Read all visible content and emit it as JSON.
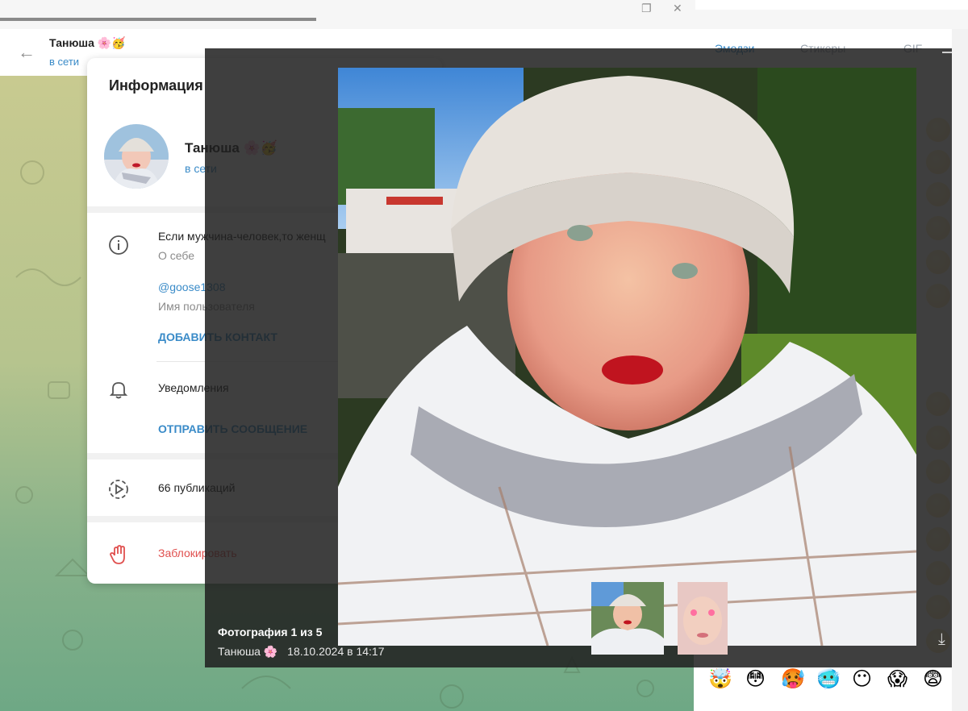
{
  "window": {
    "restore_icon": "restore-window-icon",
    "close_icon": "close-icon"
  },
  "chat": {
    "name": "Танюша 🌸🥳",
    "status": "в сети"
  },
  "emoji_panel": {
    "tabs": [
      "Эмодзи",
      "Стикеры",
      "GIF"
    ],
    "active_tab": "Эмодзи",
    "bottom_emojis": [
      "🤯",
      "😳",
      "🥵",
      "🥶",
      "😶",
      "😱",
      "😨"
    ]
  },
  "info": {
    "title": "Информация",
    "name": "Танюша 🌸🥳",
    "status": "в сети",
    "about_text": "Если мужчина-человек,то женщ",
    "about_label": "О себе",
    "username": "@goose1308",
    "username_label": "Имя пользователя",
    "add_contact": "ДОБАВИТЬ КОНТАКТ",
    "notifications": "Уведомления",
    "send_message": "ОТПРАВИТЬ СООБЩЕНИЕ",
    "publications": "66 публикаций",
    "block": "Заблокировать"
  },
  "viewer": {
    "caption_title": "Фотография 1 из 5",
    "author": "Танюша 🌸",
    "date": "18.10.2024 в 14:17",
    "download_icon": "download-icon"
  },
  "colors": {
    "accent": "#3a8bc8",
    "danger": "#e0504f",
    "overlay": "#202020"
  }
}
